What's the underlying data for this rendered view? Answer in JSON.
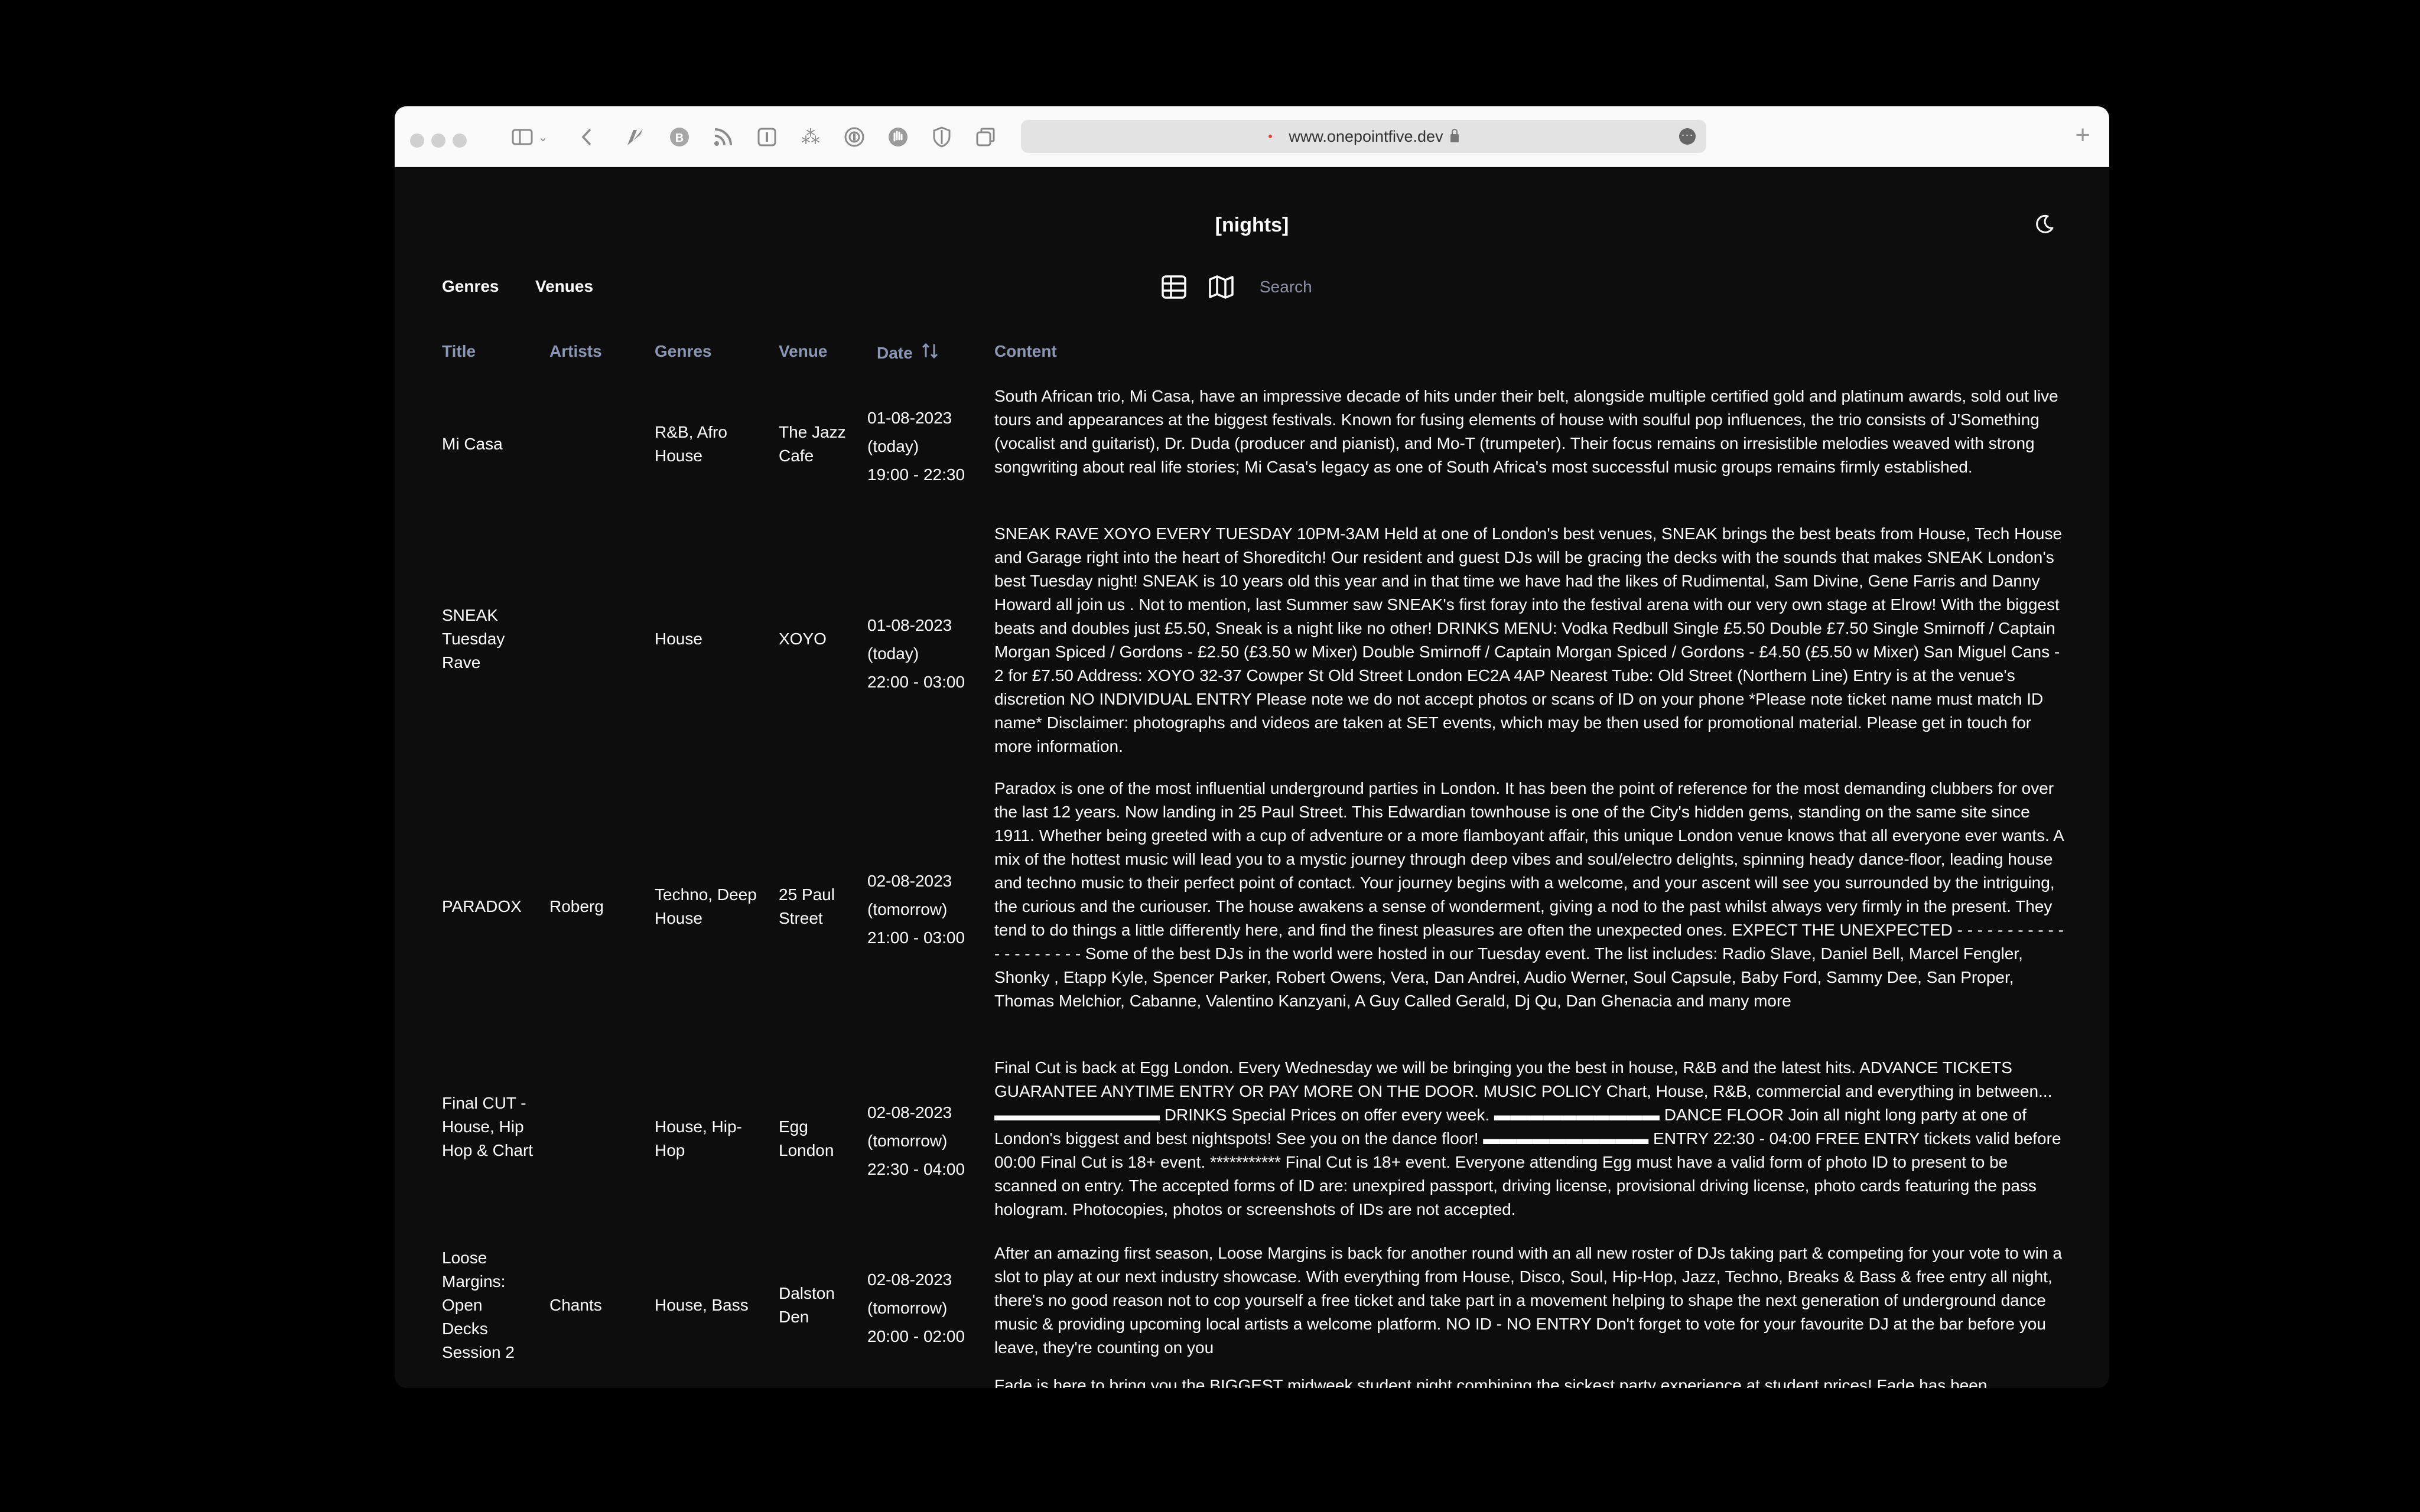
{
  "browser": {
    "url": "www.onepointfive.dev"
  },
  "site": {
    "title": "[nights]"
  },
  "nav": {
    "genres": "Genres",
    "venues": "Venues",
    "search_placeholder": "Search"
  },
  "table": {
    "headers": {
      "title": "Title",
      "artists": "Artists",
      "genres": "Genres",
      "venue": "Venue",
      "date": "Date",
      "content": "Content"
    },
    "rows": [
      {
        "title": "Mi Casa",
        "artists": "",
        "genres": "R&B, Afro House",
        "venue": "The Jazz Cafe",
        "date": "01-08-2023",
        "relative": "(today)",
        "time": "19:00 - 22:30",
        "content": "South African trio, Mi Casa, have an impressive decade of hits under their belt, alongside multiple certified gold and platinum awards, sold out live tours and appearances at the biggest festivals. Known for fusing elements of house with soulful pop influences, the trio consists of J'Something (vocalist and guitarist), Dr. Duda (producer and pianist), and Mo-T (trumpeter). Their focus remains on irresistible melodies weaved with strong songwriting about real life stories; Mi Casa's legacy as one of South Africa's most successful music groups remains firmly established."
      },
      {
        "title": "SNEAK Tuesday Rave",
        "artists": "",
        "genres": "House",
        "venue": "XOYO",
        "date": "01-08-2023",
        "relative": "(today)",
        "time": "22:00 - 03:00",
        "content": "SNEAK RAVE XOYO EVERY TUESDAY 10PM-3AM Held at one of London's best venues, SNEAK brings the best beats from House, Tech House and Garage right into the heart of Shoreditch! Our resident and guest DJs will be gracing the decks with the sounds that makes SNEAK London's best Tuesday night! SNEAK is 10 years old this year and in that time we have had the likes of Rudimental, Sam Divine, Gene Farris and Danny Howard all join us . Not to mention, last Summer saw SNEAK's first foray into the festival arena with our very own stage at Elrow! With the biggest beats and doubles just £5.50, Sneak is a night like no other! DRINKS MENU: Vodka Redbull Single £5.50 Double £7.50 Single Smirnoff / Captain Morgan Spiced / Gordons - £2.50 (£3.50 w Mixer) Double Smirnoff / Captain Morgan Spiced / Gordons - £4.50 (£5.50 w Mixer) San Miguel Cans - 2 for £7.50 Address: XOYO 32-37 Cowper St Old Street London EC2A 4AP Nearest Tube: Old Street (Northern Line) Entry is at the venue's discretion NO INDIVIDUAL ENTRY Please note we do not accept photos or scans of ID on your phone *Please note ticket name must match ID name* Disclaimer: photographs and videos are taken at SET events, which may be then used for promotional material. Please get in touch for more information."
      },
      {
        "title": "PARADOX",
        "artists": "Roberg",
        "genres": "Techno, Deep House",
        "venue": "25 Paul Street",
        "date": "02-08-2023",
        "relative": "(tomorrow)",
        "time": "21:00 - 03:00",
        "content": "Paradox is one of the most influential underground parties in London. It has been the point of reference for the most demanding clubbers for over the last 12 years. Now landing in 25 Paul Street. This Edwardian townhouse is one of the City's hidden gems, standing on the same site since 1911. Whether being greeted with a cup of adventure or a more flamboyant affair, this unique London venue knows that all everyone ever wants. A mix of the hottest music will lead you to a mystic journey through deep vibes and soul/electro delights, spinning heady dance-floor, leading house and techno music to their perfect point of contact. Your journey begins with a welcome, and your ascent will see you surrounded by the intriguing, the curious and the curiouser. The house awakens a sense of wonderment, giving a nod to the past whilst always very firmly in the present. They tend to do things a little differently here, and find the finest pleasures are often the unexpected ones. EXPECT THE UNEXPECTED - - - - - - - - - - - - - - - - - - - - Some of the best DJs in the world were hosted in our Tuesday event. The list includes: Radio Slave, Daniel Bell, Marcel Fengler, Shonky , Etapp Kyle, Spencer Parker, Robert Owens, Vera, Dan Andrei, Audio Werner, Soul Capsule, Baby Ford, Sammy Dee, San Proper, Thomas Melchior, Cabanne, Valentino Kanzyani, A Guy Called Gerald, Dj Qu, Dan Ghenacia and many more"
      },
      {
        "title": "Final CUT - House, Hip Hop & Chart",
        "artists": "",
        "genres": "House, Hip-Hop",
        "venue": "Egg London",
        "date": "02-08-2023",
        "relative": "(tomorrow)",
        "time": "22:30 - 04:00",
        "content": "Final Cut is back at Egg London. Every Wednesday we will be bringing you the best in house, R&B and the latest hits. ADVANCE TICKETS GUARANTEE ANYTIME ENTRY OR PAY MORE ON THE DOOR. MUSIC POLICY Chart, House, R&B, commercial and everything in between... ▬▬▬▬▬▬▬▬▬▬ DRINKS Special Prices on offer every week. ▬▬▬▬▬▬▬▬▬▬ DANCE FLOOR Join all night long party at one of London's biggest and best nightspots! See you on the dance floor! ▬▬▬▬▬▬▬▬▬▬ ENTRY 22:30 - 04:00 FREE ENTRY tickets valid before 00:00 Final Cut is 18+ event. *********** Final Cut is 18+ event. Everyone attending Egg must have a valid form of photo ID to present to be scanned on entry. The accepted forms of ID are: unexpired passport, driving license, provisional driving license, photo cards featuring the pass hologram. Photocopies, photos or screenshots of IDs are not accepted."
      },
      {
        "title": "Loose Margins: Open Decks Session 2",
        "artists": "Chants",
        "genres": "House, Bass",
        "venue": "Dalston Den",
        "date": "02-08-2023",
        "relative": "(tomorrow)",
        "time": "20:00 - 02:00",
        "content": "After an amazing first season, Loose Margins is back for another round with an all new roster of DJs taking part & competing for your vote to win a slot to play at our next industry showcase. With everything from House, Disco, Soul, Hip-Hop, Jazz, Techno, Breaks & Bass & free entry all night, there's no good reason not to cop yourself a free ticket and take part in a movement helping to shape the next generation of underground dance music & providing upcoming local artists a welcome platform. NO ID - NO ENTRY Don't forget to vote for your favourite DJ at the bar before you leave, they're counting on you"
      },
      {
        "content": "Fade is here to bring you the BIGGEST midweek student night combining the sickest party experience at student prices! Fade has been"
      }
    ]
  }
}
